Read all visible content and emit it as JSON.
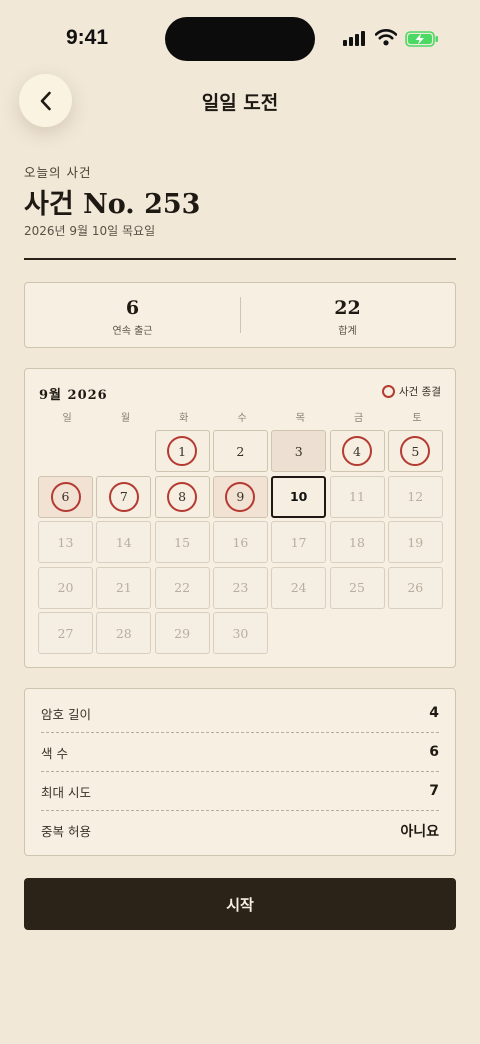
{
  "status": {
    "time": "9:41"
  },
  "header": {
    "title": "일일 도전"
  },
  "case": {
    "subtitle": "오늘의 사건",
    "title": "사건 No. 253",
    "date": "2026년 9월 10일 목요일"
  },
  "stats": [
    {
      "value": "6",
      "label": "연속 출근"
    },
    {
      "value": "22",
      "label": "합계"
    }
  ],
  "calendar": {
    "title": "9월 2026",
    "legend": "사건 종결",
    "weekdays": [
      "일",
      "월",
      "화",
      "수",
      "목",
      "금",
      "토"
    ],
    "days": [
      {
        "day": "1",
        "state": "solved"
      },
      {
        "day": "2",
        "state": "past"
      },
      {
        "day": "3",
        "state": "missed"
      },
      {
        "day": "4",
        "state": "solved"
      },
      {
        "day": "5",
        "state": "solved"
      },
      {
        "day": "6",
        "state": "solved-tinted"
      },
      {
        "day": "7",
        "state": "solved"
      },
      {
        "day": "8",
        "state": "solved"
      },
      {
        "day": "9",
        "state": "solved-tinted"
      },
      {
        "day": "10",
        "state": "today"
      },
      {
        "day": "11",
        "state": "future"
      },
      {
        "day": "12",
        "state": "future"
      },
      {
        "day": "13",
        "state": "future"
      },
      {
        "day": "14",
        "state": "future"
      },
      {
        "day": "15",
        "state": "future"
      },
      {
        "day": "16",
        "state": "future"
      },
      {
        "day": "17",
        "state": "future"
      },
      {
        "day": "18",
        "state": "future"
      },
      {
        "day": "19",
        "state": "future"
      },
      {
        "day": "20",
        "state": "future"
      },
      {
        "day": "21",
        "state": "future"
      },
      {
        "day": "22",
        "state": "future"
      },
      {
        "day": "23",
        "state": "future"
      },
      {
        "day": "24",
        "state": "future"
      },
      {
        "day": "25",
        "state": "future"
      },
      {
        "day": "26",
        "state": "future"
      },
      {
        "day": "27",
        "state": "future"
      },
      {
        "day": "28",
        "state": "future"
      },
      {
        "day": "29",
        "state": "future"
      },
      {
        "day": "30",
        "state": "future"
      }
    ]
  },
  "rules": [
    {
      "label": "암호 길이",
      "value": "4"
    },
    {
      "label": "색 수",
      "value": "6"
    },
    {
      "label": "최대 시도",
      "value": "7"
    },
    {
      "label": "중복 허용",
      "value": "아니요"
    }
  ],
  "start_button": "시작",
  "icons": {
    "back": "chevron-left-icon",
    "signal": "signal-icon",
    "wifi": "wifi-icon",
    "battery": "battery-charging-icon",
    "solved": "red-ring-icon"
  },
  "colors": {
    "background": "#f1e8d8",
    "accent_ring": "#b43a32",
    "button": "#2b2317",
    "battery": "#4cd964"
  }
}
